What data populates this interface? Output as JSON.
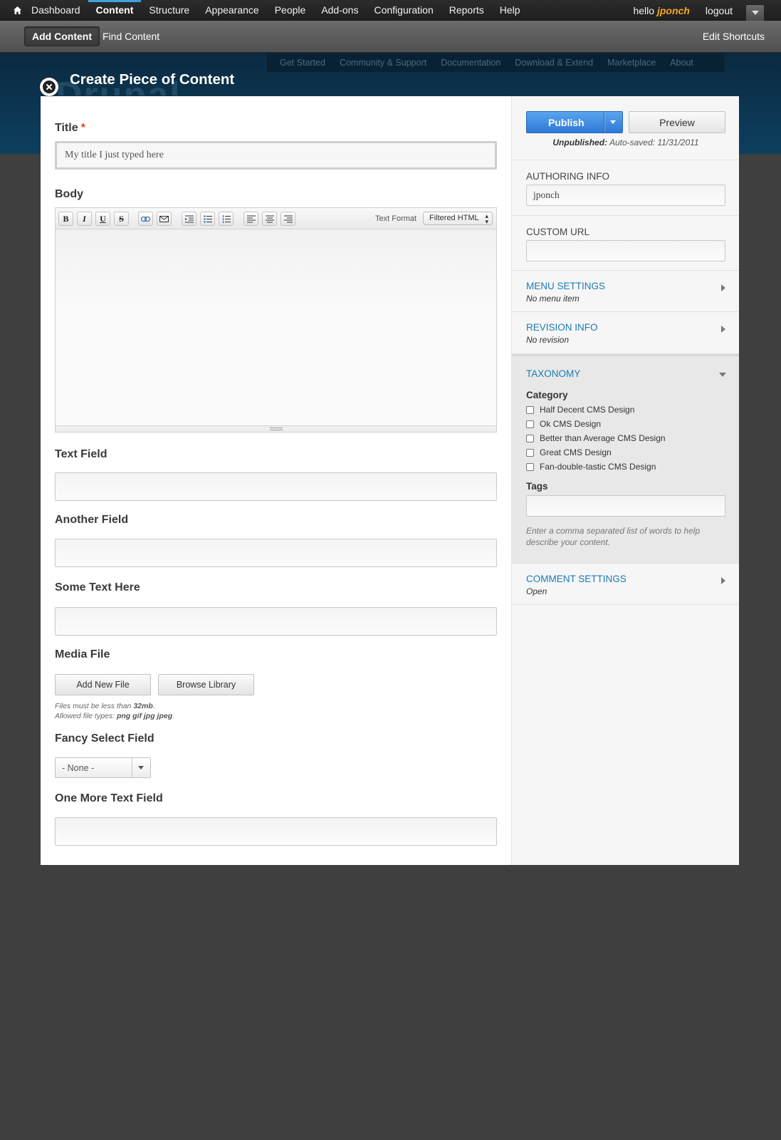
{
  "toolbar": {
    "menu": [
      "Dashboard",
      "Content",
      "Structure",
      "Appearance",
      "People",
      "Add-ons",
      "Configuration",
      "Reports",
      "Help"
    ],
    "hello": "hello",
    "username": "jponch",
    "logout": "logout"
  },
  "shortcuts": {
    "add_content": "Add Content",
    "find_content": "Find Content",
    "edit_shortcuts": "Edit Shortcuts"
  },
  "site": {
    "nav": [
      "Get Started",
      "Community & Support",
      "Documentation",
      "Download & Extend",
      "Marketplace",
      "About"
    ],
    "logo": "Drupal"
  },
  "overlay": {
    "title": "Create Piece of Content"
  },
  "form": {
    "title_label": "Title",
    "title_required": "*",
    "title_value": "My title I just typed here",
    "body_label": "Body",
    "editor": {
      "buttons": [
        "bold-icon",
        "italic-icon",
        "underline-icon",
        "strikethrough-icon",
        "link-icon",
        "email-icon",
        "indent-icon",
        "bullet-list-icon",
        "numbered-list-icon",
        "align-left-icon",
        "align-center-icon",
        "align-right-icon"
      ],
      "text_format_label": "Text Format",
      "text_format_value": "Filtered HTML"
    },
    "text_field_label": "Text Field",
    "another_field_label": "Another Field",
    "some_text_label": "Some Text Here",
    "media_label": "Media File",
    "add_new_file": "Add New File",
    "browse_library": "Browse Library",
    "media_note_1_pre": "Files must be less than",
    "media_note_1_val": "32mb",
    "media_note_1_post": ".",
    "media_note_2_pre": "Allowed file types:",
    "media_note_2_val": "png gif jpg jpeg",
    "media_note_2_post": ".",
    "fancy_select_label": "Fancy Select Field",
    "fancy_select_value": "- None -",
    "one_more_label": "One More Text Field"
  },
  "sidebar": {
    "publish": "Publish",
    "preview": "Preview",
    "status_bold": "Unpublished:",
    "status_rest": "Auto-saved: 11/31/2011",
    "authoring_title": "AUTHORING INFO",
    "authoring_value": "jponch",
    "custom_url_title": "CUSTOM URL",
    "menu_title": "MENU SETTINGS",
    "menu_sub": "No menu item",
    "revision_title": "REVISION INFO",
    "revision_sub": "No revision",
    "taxonomy_title": "TAXONOMY",
    "category_label": "Category",
    "categories": [
      "Half Decent CMS Design",
      "Ok CMS Design",
      "Better than Average CMS Design",
      "Great CMS Design",
      "Fan-double-tastic CMS Design"
    ],
    "tags_label": "Tags",
    "tags_help": "Enter a comma separated list of words to help describe your content.",
    "comment_title": "COMMENT SETTINGS",
    "comment_sub": "Open"
  },
  "colors": {
    "toolbar_bg": "#222222",
    "accent_blue": "#3ea1e0",
    "link_blue": "#1b7bb5",
    "publish_blue": "#3a86e0",
    "username_orange": "#f4a726",
    "required_red": "#e0481b",
    "page_bg": "#3f3f3f"
  }
}
